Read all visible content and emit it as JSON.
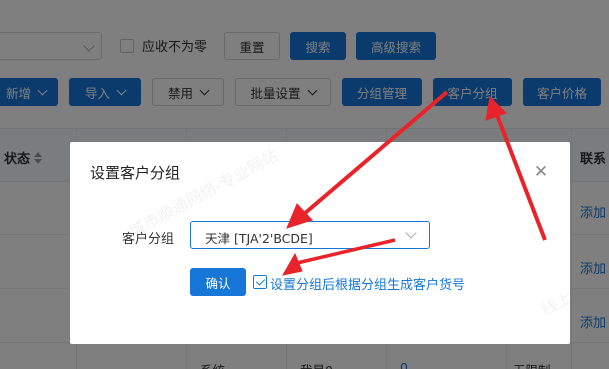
{
  "filters": {
    "checkbox_label": "应收不为零",
    "reset_label": "重置",
    "search_label": "搜索",
    "advanced_search_label": "高级搜索"
  },
  "toolbar": {
    "add_label": "新增",
    "import_label": "导入",
    "disable_label": "禁用",
    "batch_label": "批量设置",
    "group_manage_label": "分组管理",
    "customer_group_label": "客户分组",
    "customer_price_label": "客户价格"
  },
  "table": {
    "status_header": "状态",
    "contact_header": "联系",
    "add_link": "添加",
    "partial_row": [
      "系统",
      "我是0",
      "0",
      "无限制"
    ]
  },
  "modal": {
    "title": "设置客户分组",
    "field_label": "客户分组",
    "selected_group": "天津 [TJA'2'BCDE]",
    "confirm_label": "确认",
    "checkbox_label": "设置分组后根据分组生成客户货号"
  },
  "watermark": {
    "text1": "城市顺通网络-专业网站",
    "text2": "线上"
  },
  "colors": {
    "primary": "#1677d8",
    "annotation_arrow": "#e8242a"
  }
}
